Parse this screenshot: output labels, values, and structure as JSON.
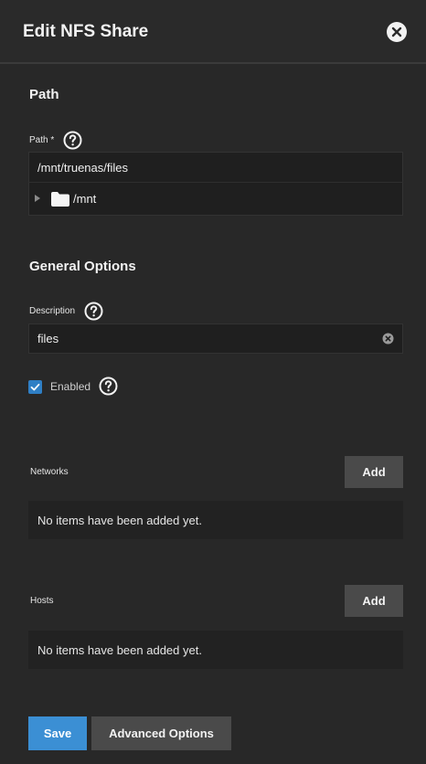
{
  "header": {
    "title": "Edit NFS Share"
  },
  "path_section": {
    "title": "Path",
    "field_label": "Path *",
    "value": "/mnt/truenas/files",
    "tree_item": "/mnt"
  },
  "general_section": {
    "title": "General Options",
    "description_label": "Description",
    "description_value": "files",
    "enabled_label": "Enabled",
    "enabled_checked": true
  },
  "networks": {
    "label": "Networks",
    "add_label": "Add",
    "empty_text": "No items have been added yet."
  },
  "hosts": {
    "label": "Hosts",
    "add_label": "Add",
    "empty_text": "No items have been added yet."
  },
  "footer": {
    "save_label": "Save",
    "advanced_label": "Advanced Options"
  },
  "colors": {
    "primary": "#3b8fd4",
    "background": "#282828",
    "input_bg": "#1f1f1f",
    "button_secondary": "#4a4a4a"
  }
}
